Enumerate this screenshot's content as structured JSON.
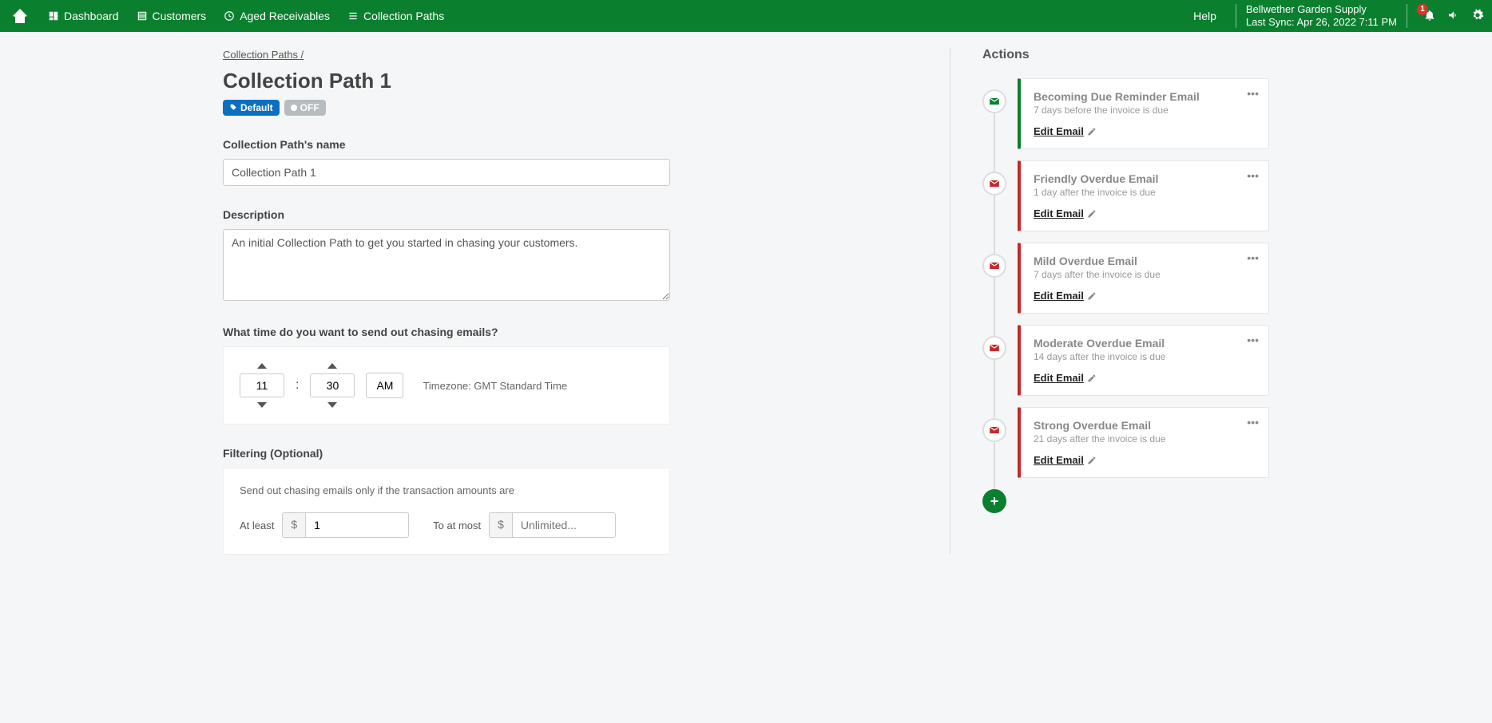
{
  "nav": {
    "dashboard": "Dashboard",
    "customers": "Customers",
    "aged": "Aged Receivables",
    "paths": "Collection Paths",
    "help": "Help"
  },
  "header": {
    "company": "Bellwether Garden Supply",
    "last_sync": "Last Sync: Apr 26, 2022 7:11 PM",
    "notif_count": "1"
  },
  "breadcrumb": "Collection Paths /",
  "page_title": "Collection Path 1",
  "badges": {
    "default": "Default",
    "off": "OFF"
  },
  "form": {
    "name_label": "Collection Path's name",
    "name_value": "Collection Path 1",
    "desc_label": "Description",
    "desc_value": "An initial Collection Path to get you started in chasing your customers.",
    "time_label": "What time do you want to send out chasing emails?",
    "time_hour": "11",
    "time_minute": "30",
    "time_ampm": "AM",
    "timezone": "Timezone: GMT Standard Time",
    "filtering_label": "Filtering (Optional)",
    "filtering_hint": "Send out chasing emails only if the transaction amounts are",
    "at_least_label": "At least",
    "at_least_value": "1",
    "at_most_label": "To at most",
    "at_most_placeholder": "Unlimited...",
    "currency": "$"
  },
  "actions_title": "Actions",
  "edit_email_label": "Edit Email",
  "actions": [
    {
      "title": "Becoming Due Reminder Email",
      "sub": "7 days before the invoice is due",
      "color": "green"
    },
    {
      "title": "Friendly Overdue Email",
      "sub": "1 day after the invoice is due",
      "color": "red"
    },
    {
      "title": "Mild Overdue Email",
      "sub": "7 days after the invoice is due",
      "color": "red"
    },
    {
      "title": "Moderate Overdue Email",
      "sub": "14 days after the invoice is due",
      "color": "red"
    },
    {
      "title": "Strong Overdue Email",
      "sub": "21 days after the invoice is due",
      "color": "red"
    }
  ]
}
